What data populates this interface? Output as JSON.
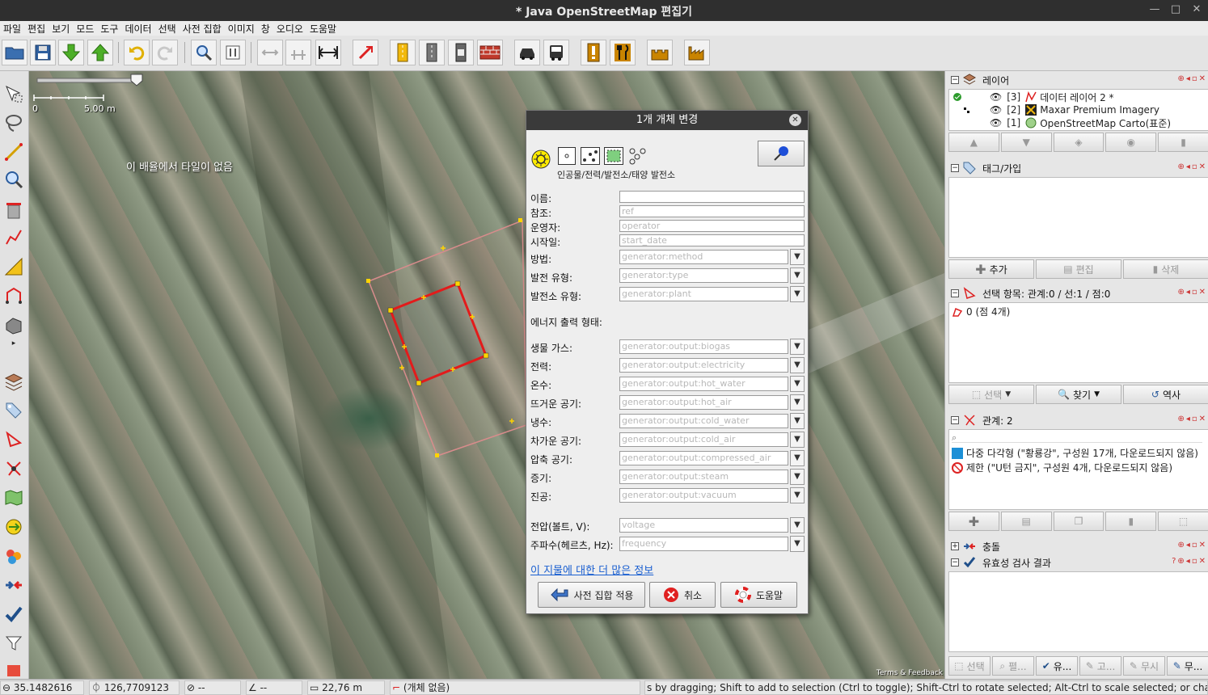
{
  "window": {
    "title": "* Java OpenStreetMap 편집기",
    "controls": [
      "—",
      "□",
      "✕"
    ]
  },
  "menu": [
    "파일",
    "편집",
    "보기",
    "모드",
    "도구",
    "데이터",
    "선택",
    "사전 집합",
    "이미지",
    "창",
    "오디오",
    "도움말"
  ],
  "map": {
    "tile_message": "이 배율에서 타일이 없음",
    "scale_zero": "0",
    "scale_label": "5.00 m",
    "attribution": "Terms & Feedback"
  },
  "dialog": {
    "title": "1개 개체 변경",
    "close": "✕",
    "preset_path": "인공물/전력/발전소/태양 발전소",
    "fields": [
      {
        "label": "이름:",
        "placeholder": ""
      },
      {
        "label": "참조:",
        "placeholder": "ref"
      },
      {
        "label": "운영자:",
        "placeholder": "operator"
      },
      {
        "label": "시작일:",
        "placeholder": "start_date"
      }
    ],
    "combos_top": [
      {
        "label": "방법:",
        "placeholder": "generator:method"
      },
      {
        "label": "발전 유형:",
        "placeholder": "generator:type"
      },
      {
        "label": "발전소 유형:",
        "placeholder": "generator:plant"
      }
    ],
    "section_title": "에너지 출력 형태:",
    "combos_output": [
      {
        "label": "생물 가스:",
        "placeholder": "generator:output:biogas"
      },
      {
        "label": "전력:",
        "placeholder": "generator:output:electricity"
      },
      {
        "label": "온수:",
        "placeholder": "generator:output:hot_water"
      },
      {
        "label": "뜨거운 공기:",
        "placeholder": "generator:output:hot_air"
      },
      {
        "label": "냉수:",
        "placeholder": "generator:output:cold_water"
      },
      {
        "label": "차가운 공기:",
        "placeholder": "generator:output:cold_air"
      },
      {
        "label": "압축 공기:",
        "placeholder": "generator:output:compressed_air"
      },
      {
        "label": "증기:",
        "placeholder": "generator:output:steam"
      },
      {
        "label": "진공:",
        "placeholder": "generator:output:vacuum"
      }
    ],
    "combos_bottom": [
      {
        "label": "전압(볼트, V):",
        "placeholder": "voltage"
      },
      {
        "label": "주파수(헤르츠, Hz):",
        "placeholder": "frequency"
      }
    ],
    "more_info_link": "이 지물에 대한 더 많은 정보",
    "buttons": {
      "apply": "사전 집합 적용",
      "cancel": "취소",
      "help": "도움말"
    }
  },
  "panels": {
    "layers": {
      "title": "레이어",
      "items": [
        {
          "index": "[3]",
          "name": "데이터 레이어 2 *"
        },
        {
          "index": "[2]",
          "name": "Maxar Premium Imagery"
        },
        {
          "index": "[1]",
          "name": "OpenStreetMap Carto(표준)"
        }
      ]
    },
    "tags": {
      "title": "태그/가입",
      "buttons": {
        "add": "추가",
        "edit": "편집",
        "delete": "삭제"
      }
    },
    "selection": {
      "title": "선택 항목: 관계:0 / 선:1 / 점:0",
      "items": [
        "0 (점 4개)"
      ],
      "buttons": {
        "select": "선택",
        "find": "찾기",
        "history": "역사"
      }
    },
    "relations": {
      "title": "관계: 2",
      "items": [
        "다중 다각형 (\"황룡강\", 구성원 17개, 다운로드되지 않음)",
        "제한 (\"U턴 금지\", 구성원 4개, 다운로드되지 않음)"
      ]
    },
    "conflicts": {
      "title": "충돌"
    },
    "validation": {
      "title": "유효성 검사 결과",
      "buttons": {
        "select": "선택",
        "zoom": "펼...",
        "validate": "유...",
        "fix": "고...",
        "ignore": "무시",
        "ignore2": "무..."
      }
    }
  },
  "status": {
    "lat": "35.1482616",
    "lon": "126,7709123",
    "heading": "--",
    "angle": "--",
    "distance": "22,76 m",
    "objects": "(개체 없음)",
    "hint": "s by dragging; Shift to add to selection (Ctrl to toggle); Shift-Ctrl to rotate selected; Alt-Ctrl to scale selected; or change selection"
  }
}
